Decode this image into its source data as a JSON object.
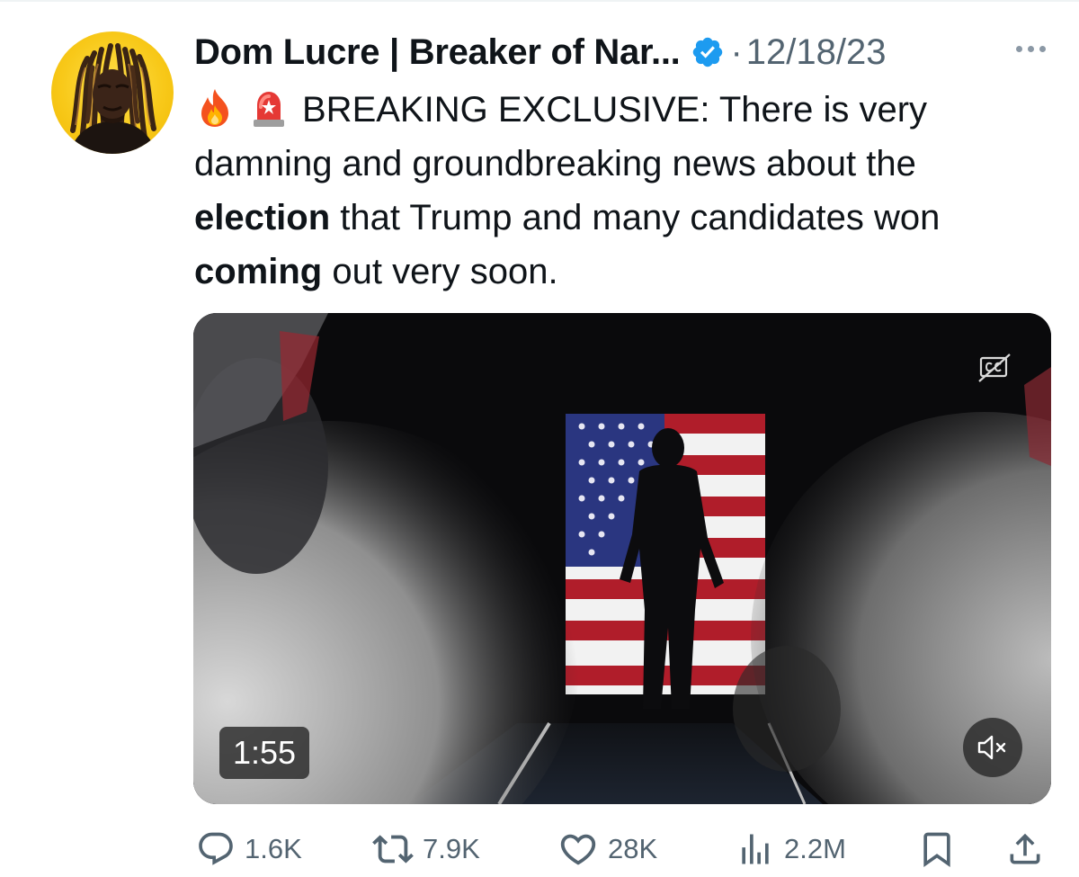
{
  "tweet": {
    "author": {
      "display_name": "Dom Lucre | Breaker of Nar...",
      "verified": true,
      "avatar_icon": "avatar-photo"
    },
    "separator": "·",
    "date": "12/18/23",
    "more_icon": "more-horizontal-icon",
    "text": {
      "emoji_1": "fire-emoji",
      "emoji_2": "siren-emoji",
      "part_1": "BREAKING EXCLUSIVE: There is very damning and groundbreaking news about the ",
      "bold_1": "election",
      "part_2": " that Trump and many candidates won ",
      "bold_2": "coming",
      "part_3": " out very soon."
    },
    "media": {
      "type": "video",
      "duration": "1:55",
      "captions_icon": "captions-off-icon",
      "mute_icon": "muted-speaker-icon"
    },
    "actions": {
      "replies": "1.6K",
      "reposts": "7.9K",
      "likes": "28K",
      "views": "2.2M",
      "bookmark_icon": "bookmark-icon",
      "share_icon": "share-icon"
    }
  },
  "colors": {
    "text_primary": "#0f1419",
    "text_secondary": "#536471",
    "verified_blue": "#1d9bf0",
    "avatar_bg": "#f8c91a"
  }
}
